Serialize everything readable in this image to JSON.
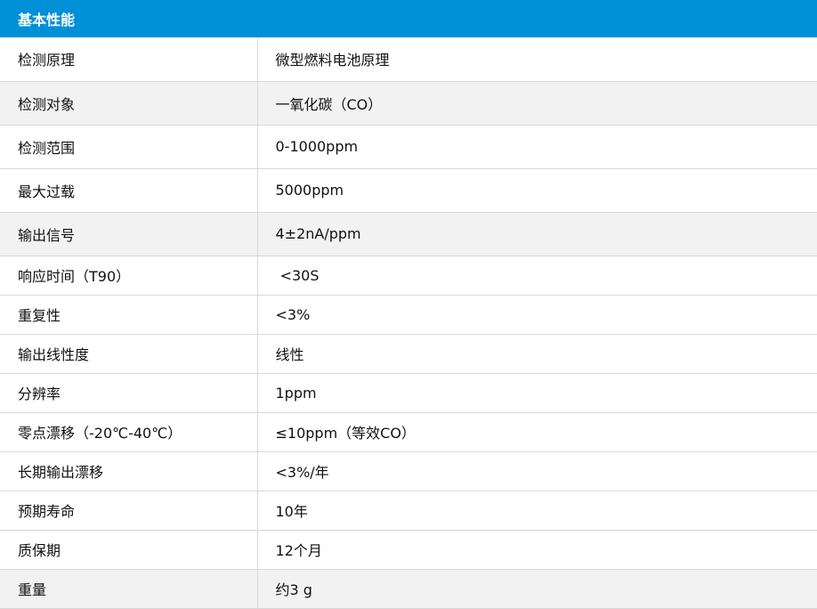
{
  "table": {
    "header": "基本性能",
    "rows": [
      {
        "param": "检测原理",
        "value": "微型燃料电池原理"
      },
      {
        "param": "检测对象",
        "value": "一氧化碳（CO）"
      },
      {
        "param": "检测范围",
        "value": "0-1000ppm"
      },
      {
        "param": "最大过载",
        "value": "5000ppm"
      },
      {
        "param": "输出信号",
        "value": "4±2nA/ppm"
      },
      {
        "param": "响应时间（T90）",
        "value": " <30S"
      },
      {
        "param": "重复性",
        "value": "<3%"
      },
      {
        "param": "输出线性度",
        "value": "线性"
      },
      {
        "param": "分辨率",
        "value": "1ppm"
      },
      {
        "param": "零点漂移（-20℃-40℃）",
        "value": "≤10ppm（等效CO）"
      },
      {
        "param": "长期输出漂移",
        "value": "<3%/年"
      },
      {
        "param": "预期寿命",
        "value": "10年"
      },
      {
        "param": "质保期",
        "value": "12个月"
      },
      {
        "param": "重量",
        "value": "约3 g"
      }
    ]
  }
}
